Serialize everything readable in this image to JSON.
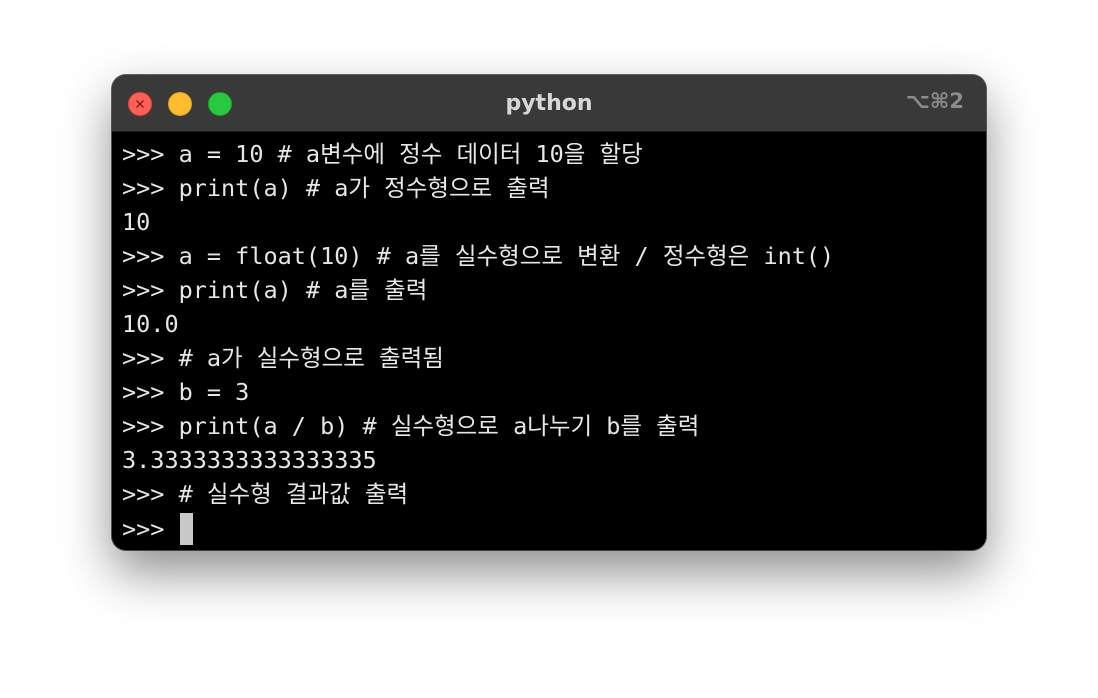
{
  "window": {
    "title": "python",
    "shortcut": "⌥⌘2"
  },
  "terminal": {
    "lines": [
      ">>> a = 10 # a변수에 정수 데이터 10을 할당",
      ">>> print(a) # a가 정수형으로 출력",
      "10",
      ">>> a = float(10) # a를 실수형으로 변환 / 정수형은 int()",
      ">>> print(a) # a를 출력",
      "10.0",
      ">>> # a가 실수형으로 출력됨",
      ">>> b = 3",
      ">>> print(a / b) # 실수형으로 a나누기 b를 출력",
      "3.3333333333333335",
      ">>> # 실수형 결과값 출력"
    ],
    "prompt": ">>>"
  },
  "colors": {
    "close": "#ff5f57",
    "minimize": "#febc2e",
    "zoom": "#28c840",
    "titlebar": "#393939",
    "background": "#000000",
    "text": "#e6e6e6"
  },
  "icons": [
    "close-icon",
    "minimize-icon",
    "zoom-icon",
    "cursor-block"
  ]
}
